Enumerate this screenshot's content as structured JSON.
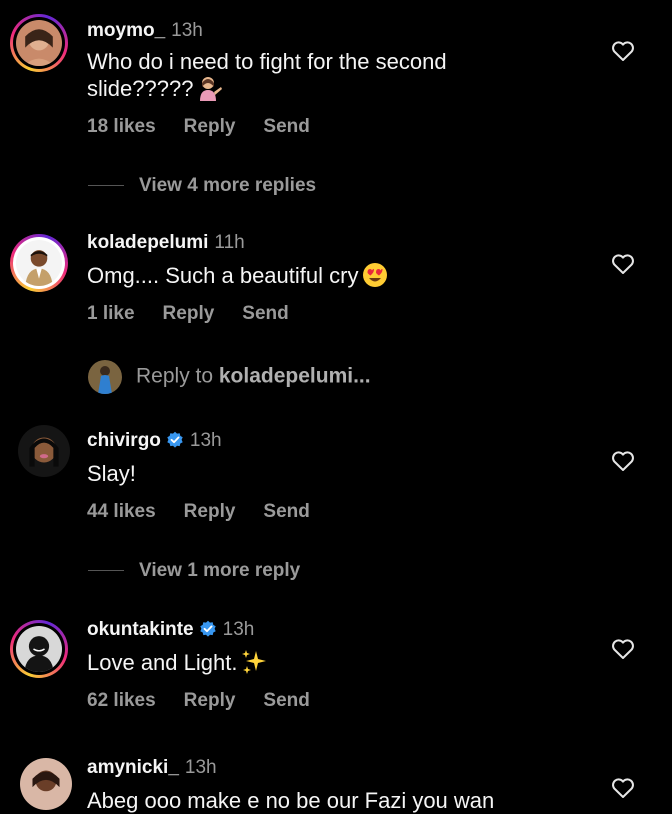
{
  "comments": [
    {
      "username": "moymo_",
      "time": "13h",
      "text": "Who do i need to fight for the second slide?????",
      "text_emoji": "person-tipping-hand",
      "likes": "18 likes",
      "reply": "Reply",
      "send": "Send",
      "view_replies": "View 4 more replies",
      "verified": false,
      "avatar_ring": true
    },
    {
      "username": "koladepelumi",
      "time": "11h",
      "text": "Omg.... Such a beautiful cry",
      "text_emoji": "heart-eyes",
      "likes": "1 like",
      "reply": "Reply",
      "send": "Send",
      "verified": false,
      "avatar_ring": true
    },
    {
      "username": "chivirgo",
      "time": "13h",
      "text": "Slay!",
      "likes": "44 likes",
      "reply": "Reply",
      "send": "Send",
      "view_replies": "View 1 more reply",
      "verified": true,
      "avatar_ring": false
    },
    {
      "username": "okuntakinte",
      "time": "13h",
      "text": "Love and Light.",
      "text_emoji": "sparkles",
      "likes": "62 likes",
      "reply": "Reply",
      "send": "Send",
      "verified": true,
      "avatar_ring": true
    },
    {
      "username": "amynicki_",
      "time": "13h",
      "text": "Abeg ooo make e no be our Fazi you wan",
      "verified": false,
      "avatar_ring": false
    }
  ],
  "reply_prompt": {
    "prefix": "Reply to ",
    "target": "koladepelumi..."
  },
  "colors": {
    "background": "#000000",
    "text": "#f5f5f5",
    "muted": "#9a9a9a",
    "verified": "#3897f0"
  }
}
